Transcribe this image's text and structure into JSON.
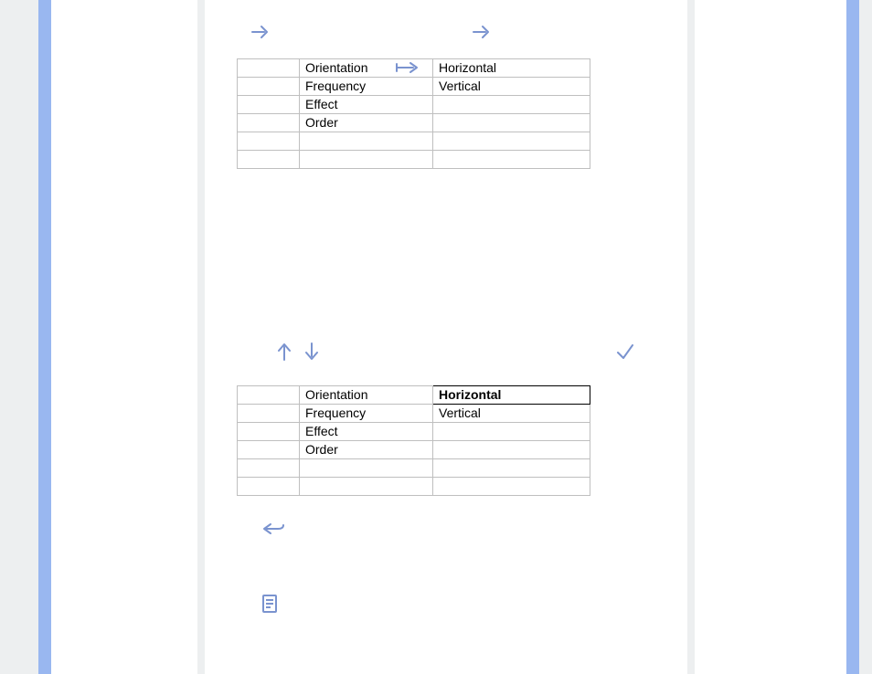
{
  "table1": {
    "rows": [
      {
        "c1": "",
        "c2": "Orientation",
        "c3": "Horizontal"
      },
      {
        "c1": "",
        "c2": "Frequency",
        "c3": "Vertical"
      },
      {
        "c1": "",
        "c2": "Effect",
        "c3": ""
      },
      {
        "c1": "",
        "c2": "Order",
        "c3": ""
      },
      {
        "c1": "",
        "c2": "",
        "c3": ""
      },
      {
        "c1": "",
        "c2": "",
        "c3": ""
      }
    ]
  },
  "table2": {
    "rows": [
      {
        "c1": "",
        "c2": "Orientation",
        "c3": "Horizontal"
      },
      {
        "c1": "",
        "c2": "Frequency",
        "c3": "Vertical"
      },
      {
        "c1": "",
        "c2": "Effect",
        "c3": ""
      },
      {
        "c1": "",
        "c2": "Order",
        "c3": ""
      },
      {
        "c1": "",
        "c2": "",
        "c3": ""
      },
      {
        "c1": "",
        "c2": "",
        "c3": ""
      }
    ]
  }
}
